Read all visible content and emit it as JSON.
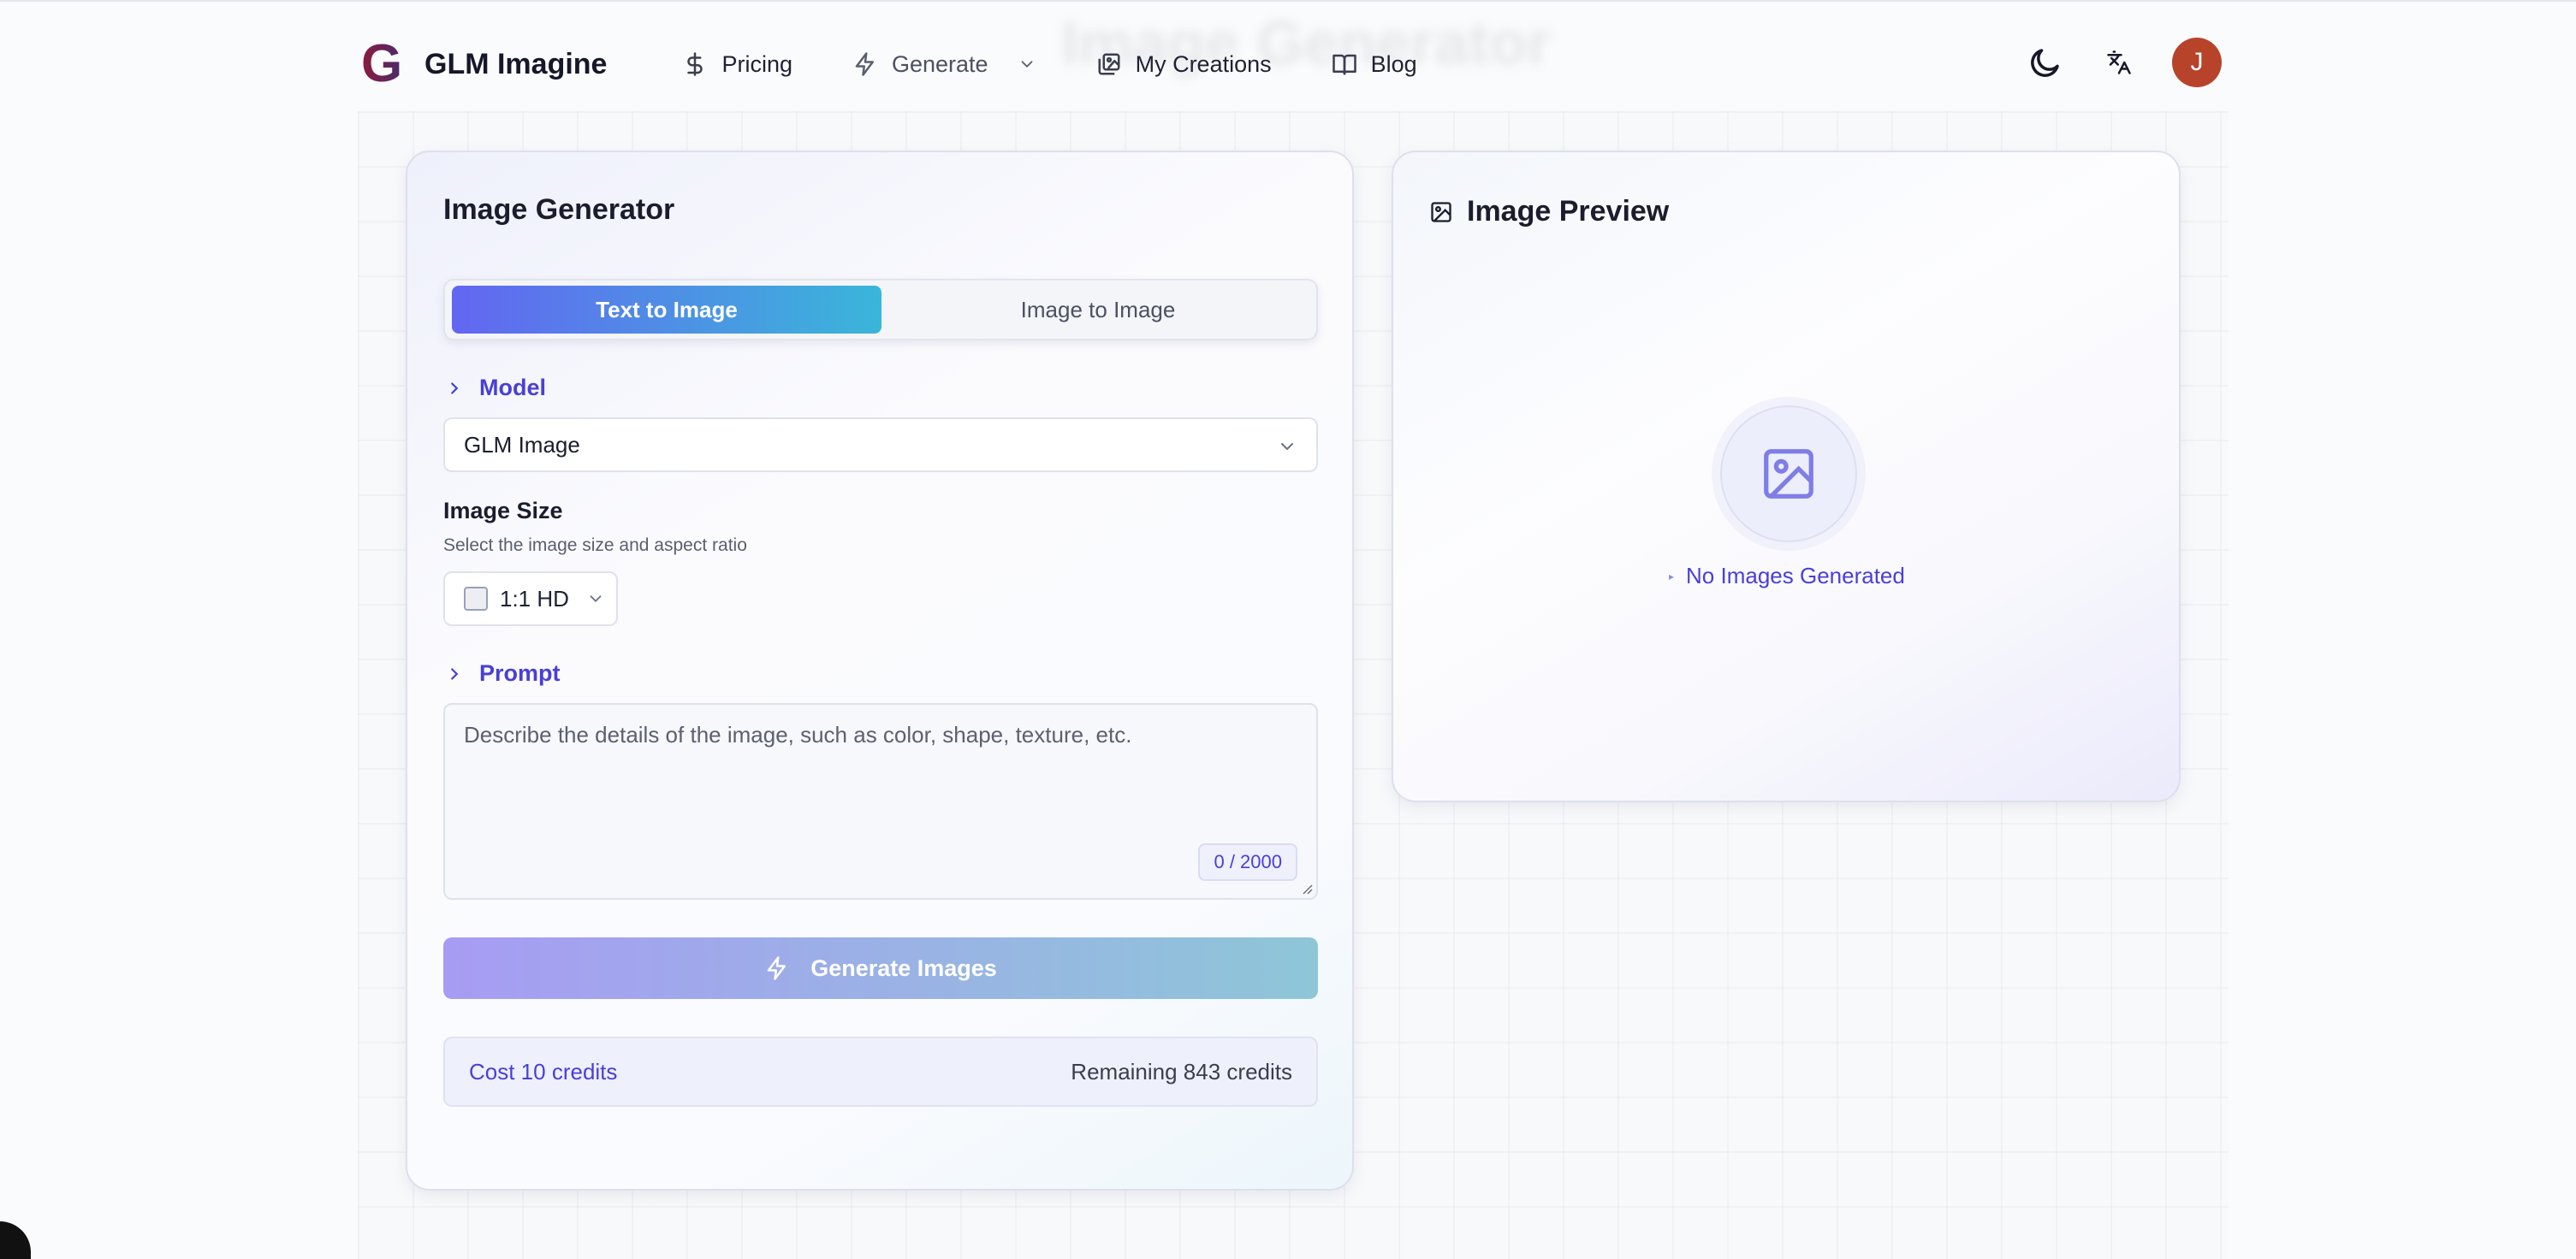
{
  "app": {
    "name": "GLM Imagine",
    "ghost_title": "Image Generator"
  },
  "nav": {
    "pricing": "Pricing",
    "generate": "Generate",
    "my_creations": "My Creations",
    "blog": "Blog"
  },
  "user": {
    "initial": "J",
    "avatar_color": "#b8432b"
  },
  "generator": {
    "title": "Image Generator",
    "tabs": [
      {
        "label": "Text to Image",
        "active": true
      },
      {
        "label": "Image to Image",
        "active": false
      }
    ],
    "model": {
      "section_label": "Model",
      "selected": "GLM Image"
    },
    "image_size": {
      "label": "Image Size",
      "help": "Select the image size and aspect ratio",
      "selected": "1:1 HD"
    },
    "prompt": {
      "section_label": "Prompt",
      "placeholder": "Describe the details of the image, such as color, shape, texture, etc.",
      "value": "",
      "counter": "0 / 2000"
    },
    "generate_button": "Generate Images",
    "cost": "Cost 10 credits",
    "remaining": "Remaining 843 credits"
  },
  "preview": {
    "title": "Image Preview",
    "empty_text": "No Images Generated"
  },
  "colors": {
    "accent": "#4a3fd6",
    "tab_gradient_start": "#6366f1",
    "tab_gradient_end": "#3ab6da"
  }
}
